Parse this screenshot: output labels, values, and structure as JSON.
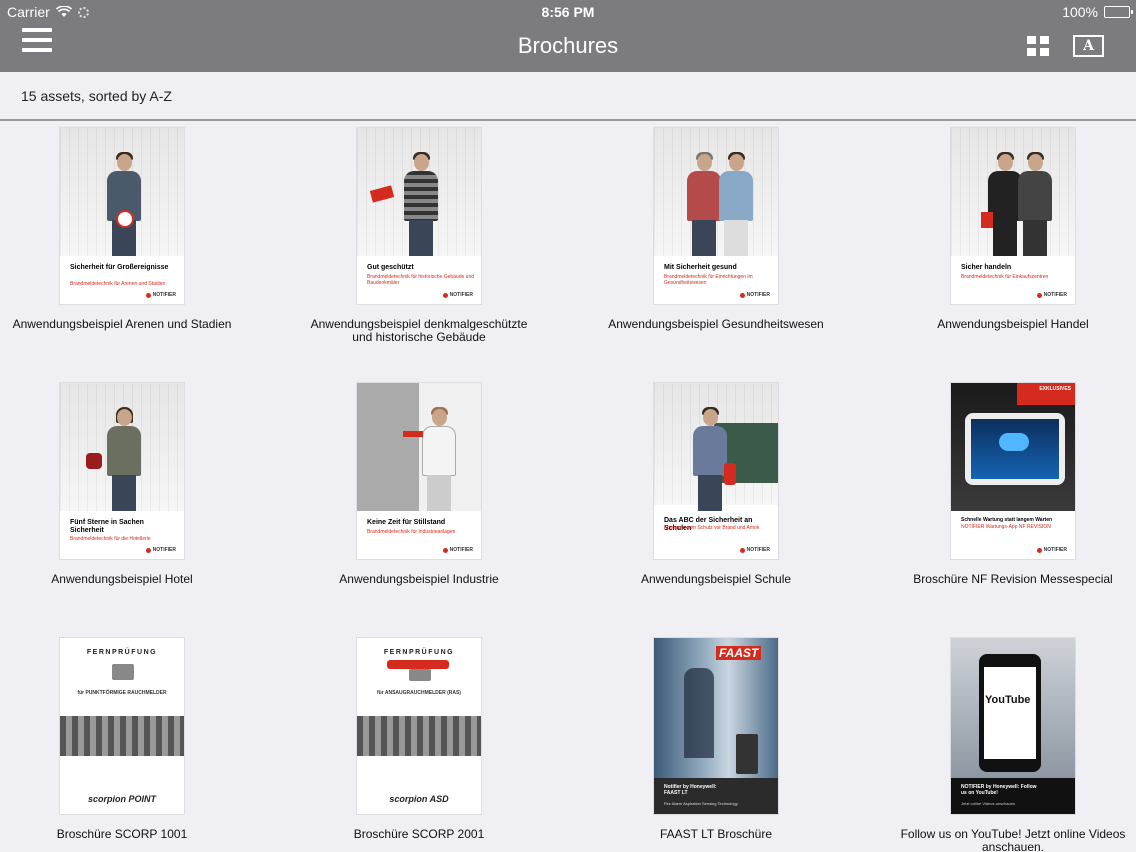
{
  "status": {
    "carrier": "Carrier",
    "time": "8:56 PM",
    "battery": "100%"
  },
  "nav": {
    "title": "Brochures",
    "font_button": "A"
  },
  "summary": "15 assets, sorted by A-Z",
  "assets": [
    {
      "label": "Anwendungsbeispiel Arenen und Stadien",
      "cover_title": "Sicherheit für Großereignisse",
      "cover_sub": "Brandmeldetechnik für Arenen und Stadien"
    },
    {
      "label": "Anwendungsbeispiel denkmalgeschützte und historische Gebäude",
      "cover_title": "Gut geschützt",
      "cover_sub": "Brandmeldetechnik für historische Gebäude und Baudenkmäler"
    },
    {
      "label": "Anwendungsbeispiel Gesundheitswesen",
      "cover_title": "Mit Sicherheit gesund",
      "cover_sub": "Brandmeldetechnik für Einrichtungen im Gesundheitswesen"
    },
    {
      "label": "Anwendungsbeispiel Handel",
      "cover_title": "Sicher handeln",
      "cover_sub": "Brandmeldetechnik für Einkaufszentren"
    },
    {
      "label": "Anwendungsbeispiel Hotel",
      "cover_title": "Fünf Sterne in Sachen Sicherheit",
      "cover_sub": "Brandmeldetechnik für die Hotellerie"
    },
    {
      "label": "Anwendungsbeispiel Industrie",
      "cover_title": "Keine Zeit für Stillstand",
      "cover_sub": "Brandmeldetechnik für Industrieanlagen"
    },
    {
      "label": "Anwendungsbeispiel Schule",
      "cover_title": "Das ABC der Sicherheit an Schulen",
      "cover_sub": "Konzepte zum Schutz vor Brand und Amok"
    },
    {
      "label": "Broschüre NF Revision Messespecial",
      "cover_title": "Schnelle Wartung statt langem Warten",
      "cover_sub": "EXKLUSIVES",
      "cover_sub_line": "NOTIFIER Wartungs-App NF REVISION"
    },
    {
      "label": "Broschüre SCORP 1001",
      "cover_title": "FERNPRÜFUNG",
      "cover_sub": "für PUNKTFÖRMIGE RAUCHMELDER",
      "cover_brand": "scorpion POINT"
    },
    {
      "label": "Broschüre SCORP 2001",
      "cover_title": "FERNPRÜFUNG",
      "cover_sub": "für ANSAUGRAUCHMELDER (RAS)",
      "cover_brand": "scorpion ASD"
    },
    {
      "label": "FAAST LT Broschüre",
      "cover_title": "Notifier by Honeywell: FAAST LT",
      "cover_sub": "Fire Alarm Aspiration Sensing Technology",
      "cover_brand": "FAAST"
    },
    {
      "label": "Follow us on YouTube! Jetzt online Videos anschauen.",
      "cover_title": "NOTIFIER by Honeywell: Follow us on YouTube!",
      "cover_sub": "Jetzt online Videos anschauen",
      "cover_brand": "YouTube"
    }
  ],
  "brand_text": "NOTIFIER",
  "colors": {
    "bar": "#7c7b7d",
    "accent": "#d52b1e",
    "background": "#efeff4"
  }
}
